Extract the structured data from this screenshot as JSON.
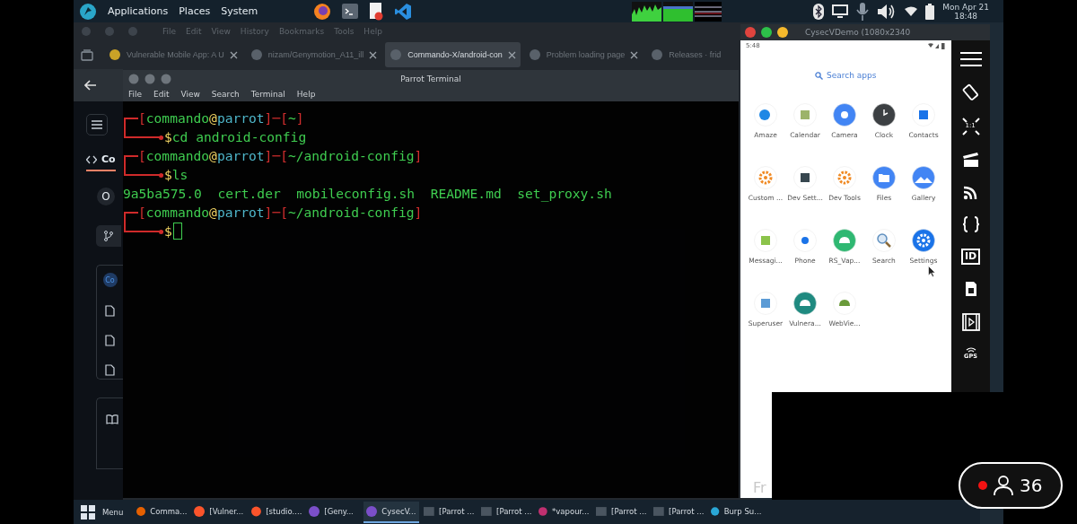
{
  "top_panel": {
    "menus": [
      "Applications",
      "Places",
      "System"
    ],
    "clock": {
      "date": "Mon Apr 21",
      "time": "18:48"
    }
  },
  "browser": {
    "menus": [
      "File",
      "Edit",
      "View",
      "History",
      "Bookmarks",
      "Tools",
      "Help"
    ],
    "tabs": [
      {
        "title": "Vulnerable Mobile App: A U",
        "selected": false
      },
      {
        "title": "nizam/Genymotion_A11_ill",
        "selected": false
      },
      {
        "title": "Commando-X/android-con",
        "selected": true
      },
      {
        "title": "Problem loading page",
        "selected": false
      },
      {
        "title": "Releases · frid",
        "selected": false,
        "closable": false
      }
    ],
    "page": {
      "code_tab": "Co",
      "repo_avatar": "O",
      "owner_avatar": "Co"
    }
  },
  "terminal": {
    "title": "Parrot Terminal",
    "menus": [
      "File",
      "Edit",
      "View",
      "Search",
      "Terminal",
      "Help"
    ],
    "lines": [
      {
        "kind": "prompt",
        "open": "[",
        "user": "commando",
        "at": "@",
        "host": "parrot",
        "sep": "]─[",
        "path": "~",
        "close": "]"
      },
      {
        "kind": "command",
        "symbol": "$",
        "text": "cd android-config"
      },
      {
        "kind": "prompt",
        "open": "[",
        "user": "commando",
        "at": "@",
        "host": "parrot",
        "sep": "]─[",
        "path": "~/android-config",
        "close": "]"
      },
      {
        "kind": "command",
        "symbol": "$",
        "text": "ls"
      },
      {
        "kind": "output",
        "items": [
          "9a5ba575.0",
          "cert.der",
          "mobileconfig.sh",
          "README.md",
          "set_proxy.sh"
        ]
      },
      {
        "kind": "prompt",
        "open": "[",
        "user": "commando",
        "at": "@",
        "host": "parrot",
        "sep": "]─[",
        "path": "~/android-config",
        "close": "]"
      },
      {
        "kind": "command",
        "symbol": "$",
        "cursor": true
      }
    ]
  },
  "emulator": {
    "title": "CysecVDemo (1080x2340",
    "status_time": "5:48",
    "search_placeholder": "Search apps",
    "apps": [
      {
        "name": "Amaze"
      },
      {
        "name": "Calendar"
      },
      {
        "name": "Camera"
      },
      {
        "name": "Clock"
      },
      {
        "name": "Contacts"
      },
      {
        "name": "Custom ..."
      },
      {
        "name": "Dev Sett..."
      },
      {
        "name": "Dev Tools"
      },
      {
        "name": "Files"
      },
      {
        "name": "Gallery"
      },
      {
        "name": "Messagi..."
      },
      {
        "name": "Phone"
      },
      {
        "name": "RS_Vap..."
      },
      {
        "name": "Search"
      },
      {
        "name": "Settings"
      },
      {
        "name": "Superuser"
      },
      {
        "name": "Vulnera..."
      },
      {
        "name": "WebVie..."
      }
    ],
    "footer_text": "Fr",
    "toolbar": [
      {
        "kind": "menu"
      },
      {
        "kind": "rotate"
      },
      {
        "kind": "scale",
        "label": "1:1"
      },
      {
        "kind": "capture"
      },
      {
        "kind": "cast"
      },
      {
        "kind": "code"
      },
      {
        "kind": "id",
        "label": "ID"
      },
      {
        "kind": "sim"
      },
      {
        "kind": "video"
      },
      {
        "kind": "gps",
        "label": "GPS"
      }
    ]
  },
  "taskbar": {
    "menu": "Menu",
    "items": [
      {
        "title": "Comma...",
        "kind": "firefox",
        "selected": false
      },
      {
        "title": "[Vulner...",
        "kind": "brave",
        "selected": false
      },
      {
        "title": "[studio....",
        "kind": "brave",
        "selected": false
      },
      {
        "title": "[Geny...",
        "kind": "geny",
        "selected": false
      },
      {
        "title": "CysecV...",
        "kind": "geny",
        "selected": true
      },
      {
        "title": "[Parrot ...",
        "kind": "terminal",
        "selected": false
      },
      {
        "title": "[Parrot ...",
        "kind": "terminal",
        "selected": false
      },
      {
        "title": "*vapour...",
        "kind": "avatar",
        "selected": false
      },
      {
        "title": "[Parrot ...",
        "kind": "terminal",
        "selected": false
      },
      {
        "title": "[Parrot ...",
        "kind": "terminal",
        "selected": false
      },
      {
        "title": "Burp Su...",
        "kind": "burp",
        "selected": false
      }
    ]
  },
  "live": {
    "recording": true,
    "viewers": "36"
  }
}
